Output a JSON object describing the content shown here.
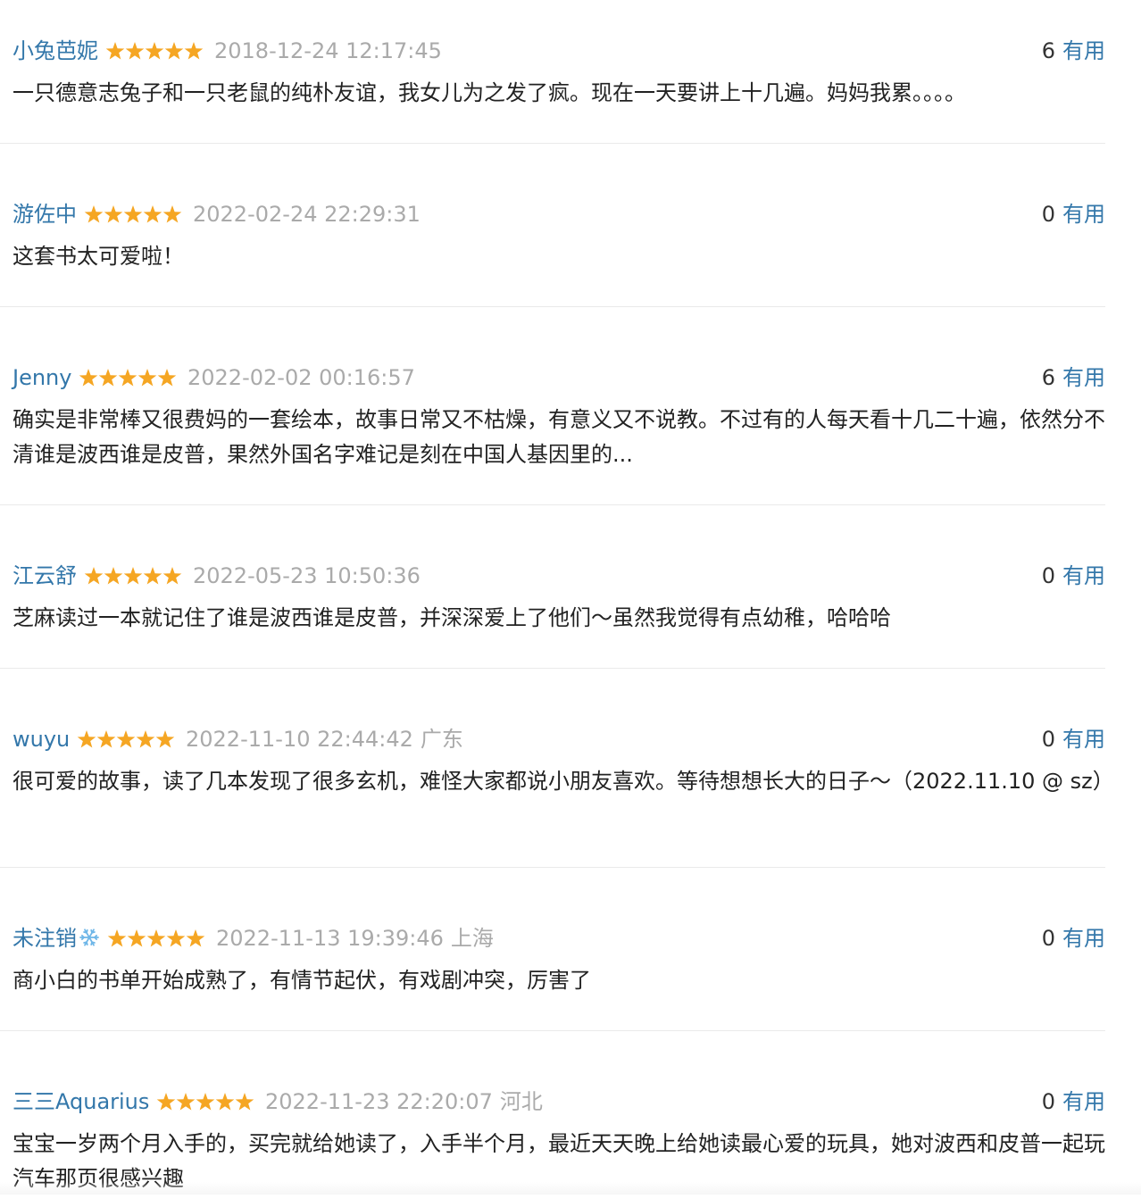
{
  "colors": {
    "username": "#3377aa",
    "star": "#f5a623",
    "meta": "#aaaaaa",
    "text": "#222222",
    "divider": "#eaeaea"
  },
  "comments": [
    {
      "user": "小兔芭妮",
      "user_icon": "",
      "rating": 5,
      "time": "2018-12-24 12:17:45",
      "location": "",
      "votes": "6",
      "useful_label": "有用",
      "text": "一只德意志兔子和一只老鼠的纯朴友谊，我女儿为之发了疯。现在一天要讲上十几遍。妈妈我累。。。。"
    },
    {
      "user": "游佐中",
      "user_icon": "",
      "rating": 5,
      "time": "2022-02-24 22:29:31",
      "location": "",
      "votes": "0",
      "useful_label": "有用",
      "text": "这套书太可爱啦！"
    },
    {
      "user": "Jenny",
      "user_icon": "",
      "rating": 5,
      "time": "2022-02-02 00:16:57",
      "location": "",
      "votes": "6",
      "useful_label": "有用",
      "text": "确实是非常棒又很费妈的一套绘本，故事日常又不枯燥，有意义又不说教。不过有的人每天看十几二十遍，依然分不清谁是波西谁是皮普，果然外国名字难记是刻在中国人基因里的..."
    },
    {
      "user": "江云舒",
      "user_icon": "",
      "rating": 5,
      "time": "2022-05-23 10:50:36",
      "location": "",
      "votes": "0",
      "useful_label": "有用",
      "text": "芝麻读过一本就记住了谁是波西谁是皮普，并深深爱上了他们～虽然我觉得有点幼稚，哈哈哈"
    },
    {
      "user": "wuyu",
      "user_icon": "",
      "rating": 5,
      "time": "2022-11-10 22:44:42",
      "location": "广东",
      "votes": "0",
      "useful_label": "有用",
      "text": "很可爱的故事，读了几本发现了很多玄机，难怪大家都说小朋友喜欢。等待想想长大的日子～（2022.11.10 @ sz）"
    },
    {
      "user": "未注销",
      "user_icon": "snowflake-icon",
      "rating": 5,
      "time": "2022-11-13 19:39:46",
      "location": "上海",
      "votes": "0",
      "useful_label": "有用",
      "text": "商小白的书单开始成熟了，有情节起伏，有戏剧冲突，厉害了"
    },
    {
      "user": "三三Aquarius",
      "user_icon": "",
      "rating": 5,
      "time": "2022-11-23 22:20:07",
      "location": "河北",
      "votes": "0",
      "useful_label": "有用",
      "text": "宝宝一岁两个月入手的，买完就给她读了，入手半个月，最近天天晚上给她读最心爱的玩具，她对波西和皮普一起玩汽车那页很感兴趣"
    }
  ]
}
